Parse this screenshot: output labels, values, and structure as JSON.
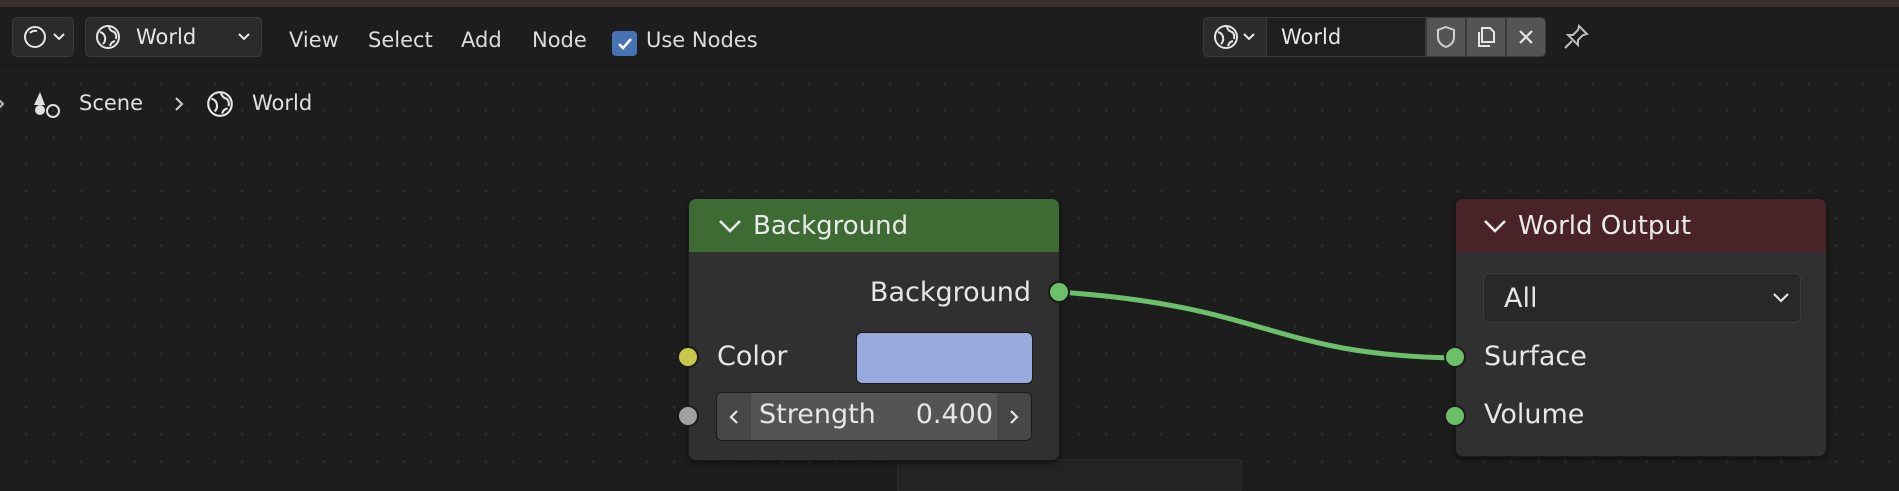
{
  "header": {
    "world_selector": {
      "label": "World"
    },
    "menus": [
      "View",
      "Select",
      "Add",
      "Node"
    ],
    "use_nodes": {
      "label": "Use Nodes",
      "checked": true
    },
    "datablock": {
      "name": "World"
    }
  },
  "breadcrumb": {
    "scene": "Scene",
    "world": "World"
  },
  "nodes": {
    "background": {
      "title": "Background",
      "output_label": "Background",
      "color_label": "Color",
      "color_value": "#98a9de",
      "strength_label": "Strength",
      "strength_value": "0.400",
      "header_color": "#3d6b33"
    },
    "world_output": {
      "title": "World Output",
      "target": "All",
      "surface_label": "Surface",
      "volume_label": "Volume",
      "header_color": "#4a2328"
    }
  },
  "colors": {
    "shader_socket": "#6cc06a",
    "color_socket": "#c7c74a",
    "float_socket": "#a1a1a1",
    "accent": "#4772b3"
  }
}
